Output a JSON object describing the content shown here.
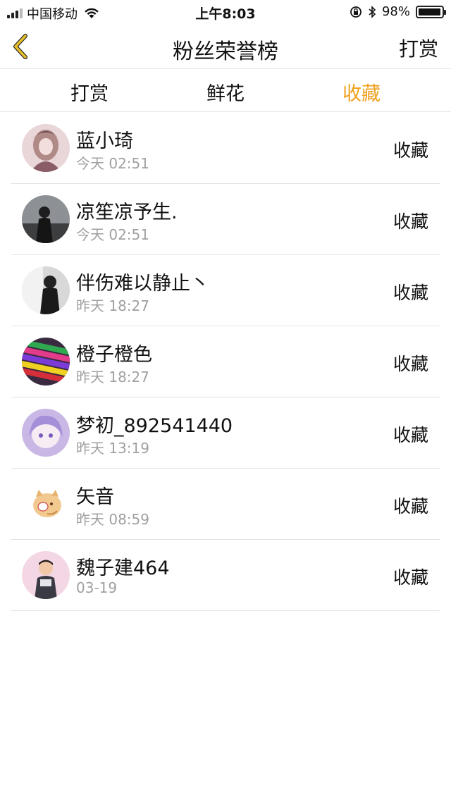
{
  "status_bar": {
    "carrier": "中国移动",
    "time": "上午8:03",
    "battery": "98%",
    "battery_level": 0.98
  },
  "nav": {
    "title": "粉丝荣誉榜",
    "right_action": "打赏",
    "back_icon": "chevron-left-icon"
  },
  "tabs": [
    {
      "label": "打赏",
      "active": false
    },
    {
      "label": "鲜花",
      "active": false
    },
    {
      "label": "收藏",
      "active": true
    }
  ],
  "colors": {
    "accent": "#f0a01c",
    "back_icon": "#e8c02a",
    "secondary_text": "#a0a0a0",
    "divider": "#e3e3e3"
  },
  "items": [
    {
      "name": "蓝小琦",
      "time": "今天 02:51",
      "action": "收藏"
    },
    {
      "name": "凉笙凉予生.",
      "time": "今天 02:51",
      "action": "收藏"
    },
    {
      "name": "伴伤难以静止丶",
      "time": "昨天 18:27",
      "action": "收藏"
    },
    {
      "name": "橙子橙色",
      "time": "昨天 18:27",
      "action": "收藏"
    },
    {
      "name": "梦初_892541440",
      "time": "昨天 13:19",
      "action": "收藏"
    },
    {
      "name": "矢音",
      "time": "昨天 08:59",
      "action": "收藏"
    },
    {
      "name": "魏子建464",
      "time": "03-19",
      "action": "收藏"
    }
  ]
}
